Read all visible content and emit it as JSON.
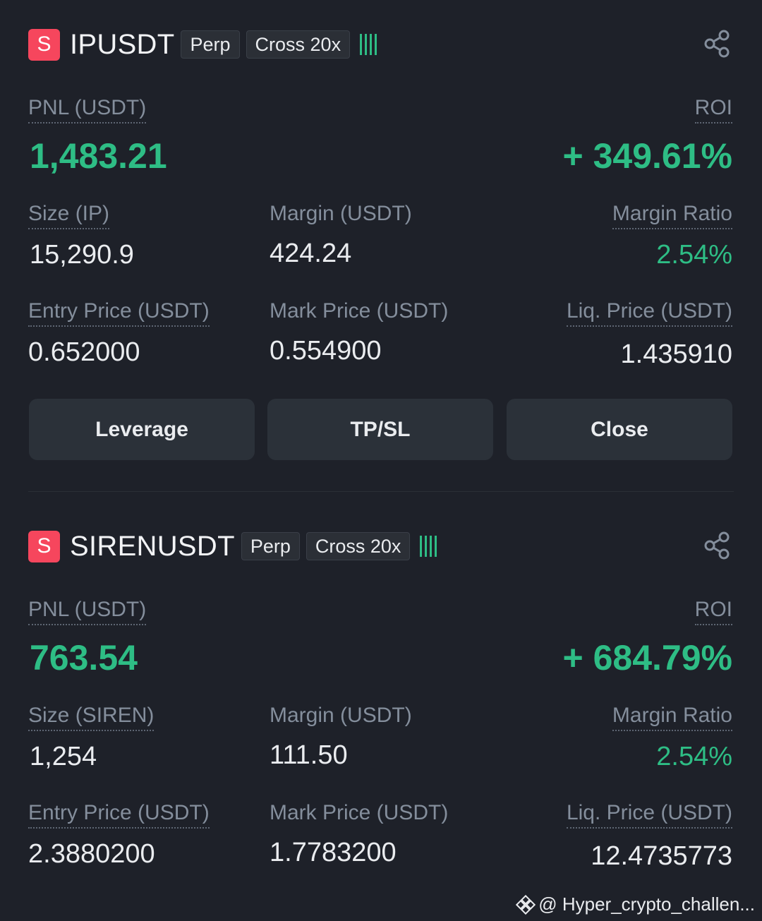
{
  "positions": [
    {
      "badge": "S",
      "symbol": "IPUSDT",
      "type_tag": "Perp",
      "margin_tag": "Cross 20x",
      "pnl_label": "PNL (USDT)",
      "pnl_value": "1,483.21",
      "roi_label": "ROI",
      "roi_value": "+ 349.61%",
      "size_label": "Size (IP)",
      "size_value": "15,290.9",
      "margin_label": "Margin (USDT)",
      "margin_value": "424.24",
      "margin_ratio_label": "Margin Ratio",
      "margin_ratio_value": "2.54%",
      "entry_label": "Entry Price (USDT)",
      "entry_value": "0.652000",
      "mark_label": "Mark Price (USDT)",
      "mark_value": "0.554900",
      "liq_label": "Liq. Price (USDT)",
      "liq_value": "1.435910"
    },
    {
      "badge": "S",
      "symbol": "SIRENUSDT",
      "type_tag": "Perp",
      "margin_tag": "Cross 20x",
      "pnl_label": "PNL (USDT)",
      "pnl_value": "763.54",
      "roi_label": "ROI",
      "roi_value": "+ 684.79%",
      "size_label": "Size (SIREN)",
      "size_value": "1,254",
      "margin_label": "Margin (USDT)",
      "margin_value": "111.50",
      "margin_ratio_label": "Margin Ratio",
      "margin_ratio_value": "2.54%",
      "entry_label": "Entry Price (USDT)",
      "entry_value": "2.3880200",
      "mark_label": "Mark Price (USDT)",
      "mark_value": "1.7783200",
      "liq_label": "Liq. Price (USDT)",
      "liq_value": "12.4735773"
    }
  ],
  "actions": {
    "leverage": "Leverage",
    "tpsl": "TP/SL",
    "close": "Close"
  },
  "watermark": "@ Hyper_crypto_challen...",
  "colors": {
    "background": "#1e2129",
    "profit_green": "#2ebd85",
    "badge_red": "#f6465d",
    "button_bg": "#2b3139"
  },
  "icons": {
    "share": "share-icon",
    "signal": "signal-bars-icon",
    "logo": "binance-logo-icon"
  }
}
